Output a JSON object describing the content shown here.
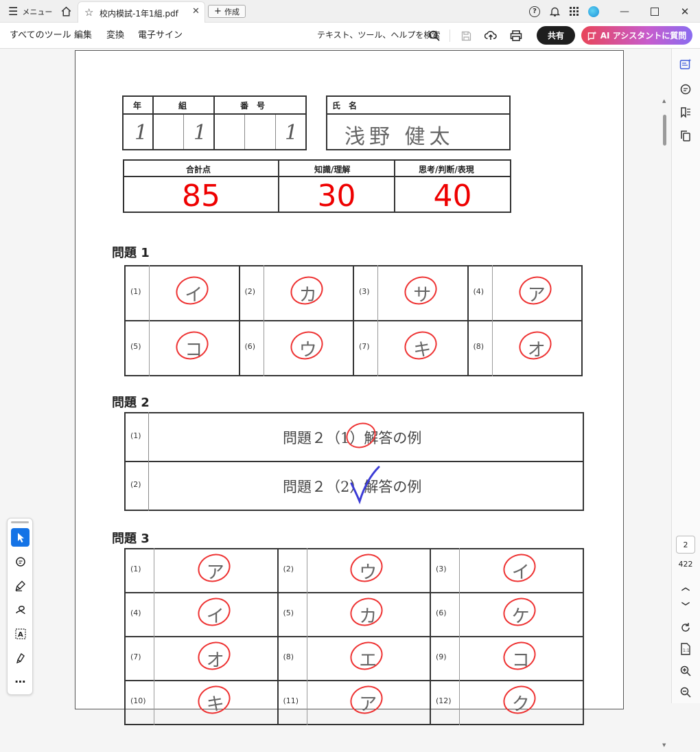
{
  "titlebar": {
    "menu_label": "メニュー",
    "tab_title": "校内模試-1年1組.pdf",
    "create_label": "作成"
  },
  "toolbar": {
    "menu_items": [
      "すべてのツール",
      "編集",
      "変換",
      "電子サイン"
    ],
    "search_label": "テキスト、ツール、ヘルプを検索",
    "share_label": "共有",
    "ai_label": "AI アシスタントに質問"
  },
  "nav": {
    "page_number": "2",
    "page_total": "422"
  },
  "sheet": {
    "header": {
      "year_label": "年",
      "class_label": "組",
      "number_label": "番　号",
      "name_label": "氏　名",
      "year_value": "1",
      "class_value": "1",
      "number_value": "1",
      "student_name": "浅野 健太"
    },
    "scores": {
      "total_label": "合計点",
      "knowledge_label": "知識/理解",
      "thinking_label": "思考/判断/表現",
      "total": "85",
      "knowledge": "30",
      "thinking": "40"
    },
    "q1": {
      "title": "問題 1",
      "items": [
        {
          "label": "(1)",
          "answer": "イ"
        },
        {
          "label": "(2)",
          "answer": "カ"
        },
        {
          "label": "(3)",
          "answer": "サ"
        },
        {
          "label": "(4)",
          "answer": "ア"
        },
        {
          "label": "(5)",
          "answer": "コ"
        },
        {
          "label": "(6)",
          "answer": "ウ"
        },
        {
          "label": "(7)",
          "answer": "キ"
        },
        {
          "label": "(8)",
          "answer": "オ"
        }
      ]
    },
    "q2": {
      "title": "問題 2",
      "items": [
        {
          "label": "(1)",
          "text": "問題２（1）解答の例"
        },
        {
          "label": "(2)",
          "text": "問題２（2）解答の例"
        }
      ]
    },
    "q3": {
      "title": "問題 3",
      "items": [
        {
          "label": "(1)",
          "answer": "ア"
        },
        {
          "label": "(2)",
          "answer": "ウ"
        },
        {
          "label": "(3)",
          "answer": "イ"
        },
        {
          "label": "(4)",
          "answer": "イ"
        },
        {
          "label": "(5)",
          "answer": "カ"
        },
        {
          "label": "(6)",
          "answer": "ケ"
        },
        {
          "label": "(7)",
          "answer": "オ"
        },
        {
          "label": "(8)",
          "answer": "エ"
        },
        {
          "label": "(9)",
          "answer": "コ"
        },
        {
          "label": "(10)",
          "answer": "キ"
        },
        {
          "label": "(11)",
          "answer": "ア"
        },
        {
          "label": "(12)",
          "answer": "ク"
        }
      ]
    }
  },
  "colors": {
    "mark_red": "#e33333",
    "check_blue": "#3b3bd6",
    "active_tool": "#1473e6"
  }
}
